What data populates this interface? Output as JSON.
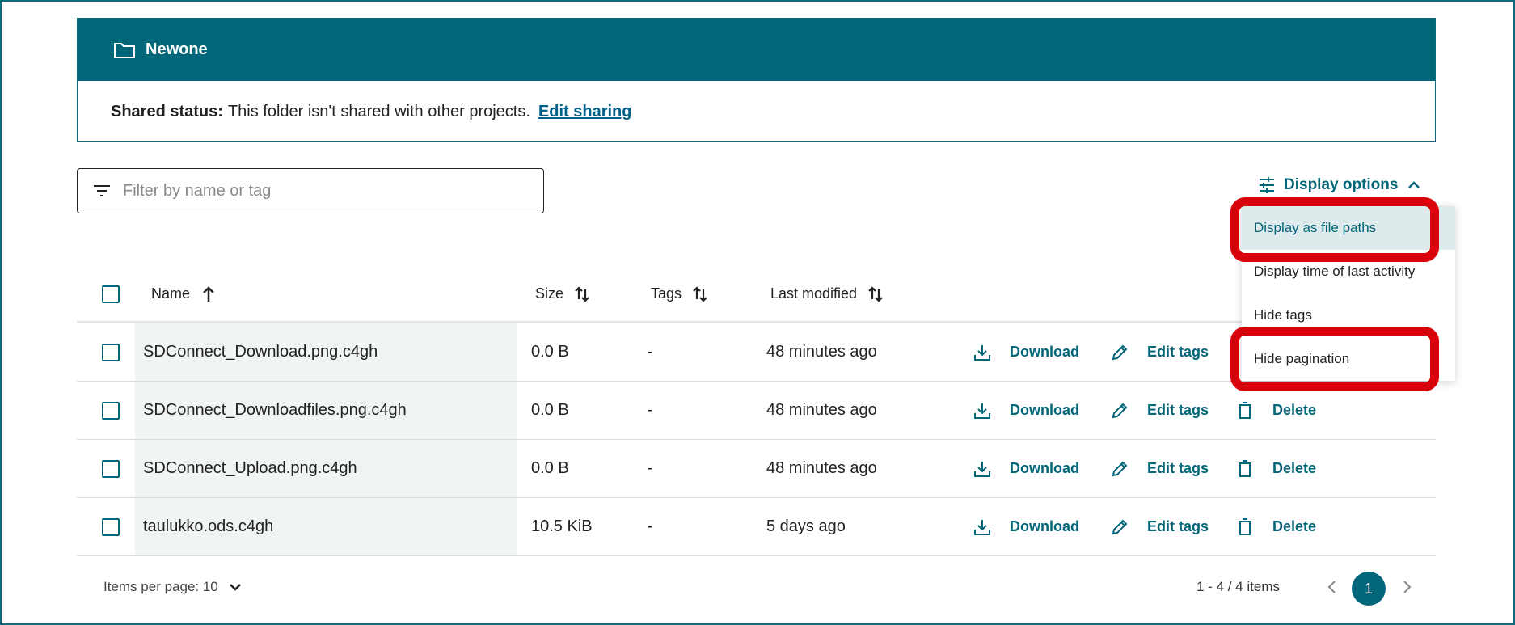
{
  "folder": {
    "title": "Newone",
    "status_label": "Shared status:",
    "status_text": "This folder isn't shared with other projects.",
    "edit_sharing": "Edit sharing"
  },
  "filter": {
    "placeholder": "Filter by name or tag"
  },
  "display_options": {
    "label": "Display options",
    "menu": [
      "Display as file paths",
      "Display time of last activity",
      "Hide tags",
      "Hide pagination"
    ]
  },
  "table": {
    "columns": {
      "name": "Name",
      "size": "Size",
      "tags": "Tags",
      "last_modified": "Last modified"
    },
    "actions": {
      "download": "Download",
      "edit_tags": "Edit tags",
      "delete": "Delete"
    },
    "rows": [
      {
        "name": "SDConnect_Download.png.c4gh",
        "size": "0.0 B",
        "tags": "-",
        "modified": "48 minutes ago"
      },
      {
        "name": "SDConnect_Downloadfiles.png.c4gh",
        "size": "0.0 B",
        "tags": "-",
        "modified": "48 minutes ago"
      },
      {
        "name": "SDConnect_Upload.png.c4gh",
        "size": "0.0 B",
        "tags": "-",
        "modified": "48 minutes ago"
      },
      {
        "name": "taulukko.ods.c4gh",
        "size": "10.5 KiB",
        "tags": "-",
        "modified": "5 days ago"
      }
    ]
  },
  "pagination": {
    "items_per_page": "Items per page: 10",
    "range": "1 - 4 / 4 items",
    "current_page": "1"
  },
  "colors": {
    "primary": "#036679",
    "highlight": "#d8020a"
  }
}
